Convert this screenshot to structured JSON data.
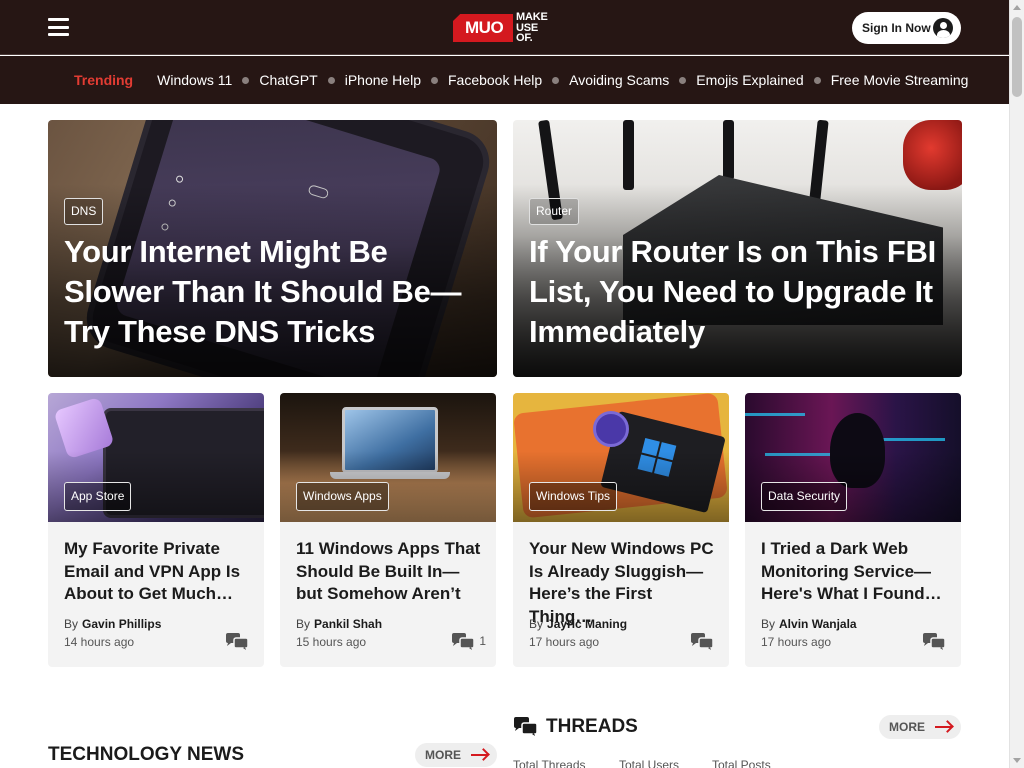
{
  "header": {
    "logo": {
      "box_text": "MUO",
      "words": [
        "MAKE",
        "USE",
        "OF."
      ]
    },
    "signin_label": "Sign In Now"
  },
  "trending": {
    "label": "Trending",
    "items": [
      "Windows 11",
      "ChatGPT",
      "iPhone Help",
      "Facebook Help",
      "Avoiding Scams",
      "Emojis Explained",
      "Free Movie Streaming"
    ]
  },
  "hero": [
    {
      "tag": "DNS",
      "title": "Your Internet Might Be Slower Than It Should Be—Try These DNS Tricks"
    },
    {
      "tag": "Router",
      "title": "If Your Router Is on This FBI List, You Need to Upgrade It Immediately"
    }
  ],
  "cards": [
    {
      "tag": "App Store",
      "title": "My Favorite Private Email and VPN App Is About to Get Much…",
      "by": "By",
      "author": "Gavin Phillips",
      "time": "14 hours ago",
      "comments": ""
    },
    {
      "tag": "Windows Apps",
      "title": "11 Windows Apps That Should Be Built In—but Somehow Aren’t",
      "by": "By",
      "author": "Pankil Shah",
      "time": "15 hours ago",
      "comments": "1"
    },
    {
      "tag": "Windows Tips",
      "title": "Your New Windows PC Is Already Sluggish—Here’s the First Thing…",
      "by": "By",
      "author": "Jayric Maning",
      "time": "17 hours ago",
      "comments": ""
    },
    {
      "tag": "Data Security",
      "title": "I Tried a Dark Web Monitoring Service—Here's What I Found…",
      "by": "By",
      "author": "Alvin Wanjala",
      "time": "17 hours ago",
      "comments": ""
    }
  ],
  "threads": {
    "title": "THREADS",
    "more": "MORE",
    "stats": [
      "Total Threads",
      "Total Users",
      "Total Posts"
    ]
  },
  "tech_news": {
    "title": "TECHNOLOGY NEWS",
    "more": "MORE"
  },
  "colors": {
    "header_bg": "#261614",
    "accent": "#d4191f",
    "trending_label": "#e23c33"
  }
}
